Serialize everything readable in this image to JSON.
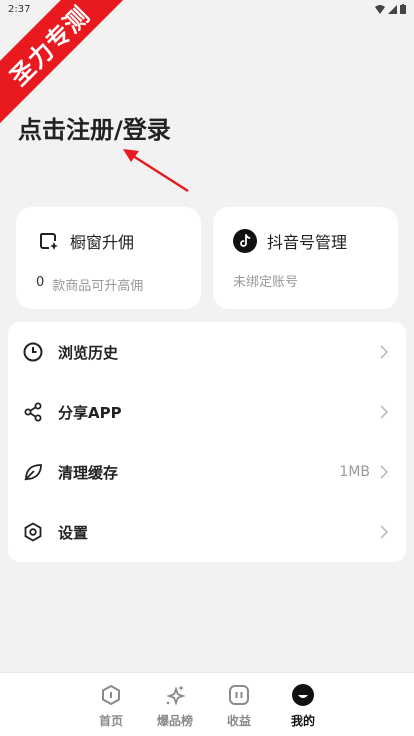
{
  "status_bar": {
    "time": "2:37"
  },
  "ribbon": {
    "text": "圣力专测"
  },
  "login": {
    "title": "点击注册/登录"
  },
  "cards": {
    "window": {
      "title": "橱窗升佣",
      "count": "0",
      "subtitle": "款商品可升高佣"
    },
    "douyin": {
      "title": "抖音号管理",
      "subtitle": "未绑定账号"
    }
  },
  "menu": {
    "history": {
      "label": "浏览历史",
      "icon": "clock-icon"
    },
    "share": {
      "label": "分享APP",
      "icon": "share-icon"
    },
    "cache": {
      "label": "清理缓存",
      "value": "1MB",
      "icon": "leaf-icon"
    },
    "settings": {
      "label": "设置",
      "icon": "hexagon-icon"
    }
  },
  "tabs": {
    "home": {
      "label": "首页"
    },
    "hot": {
      "label": "爆品榜"
    },
    "income": {
      "label": "收益"
    },
    "mine": {
      "label": "我的"
    }
  },
  "colors": {
    "accent": "#e8191f",
    "background": "#f2f2f3",
    "text": "#222222",
    "muted": "#999999"
  }
}
